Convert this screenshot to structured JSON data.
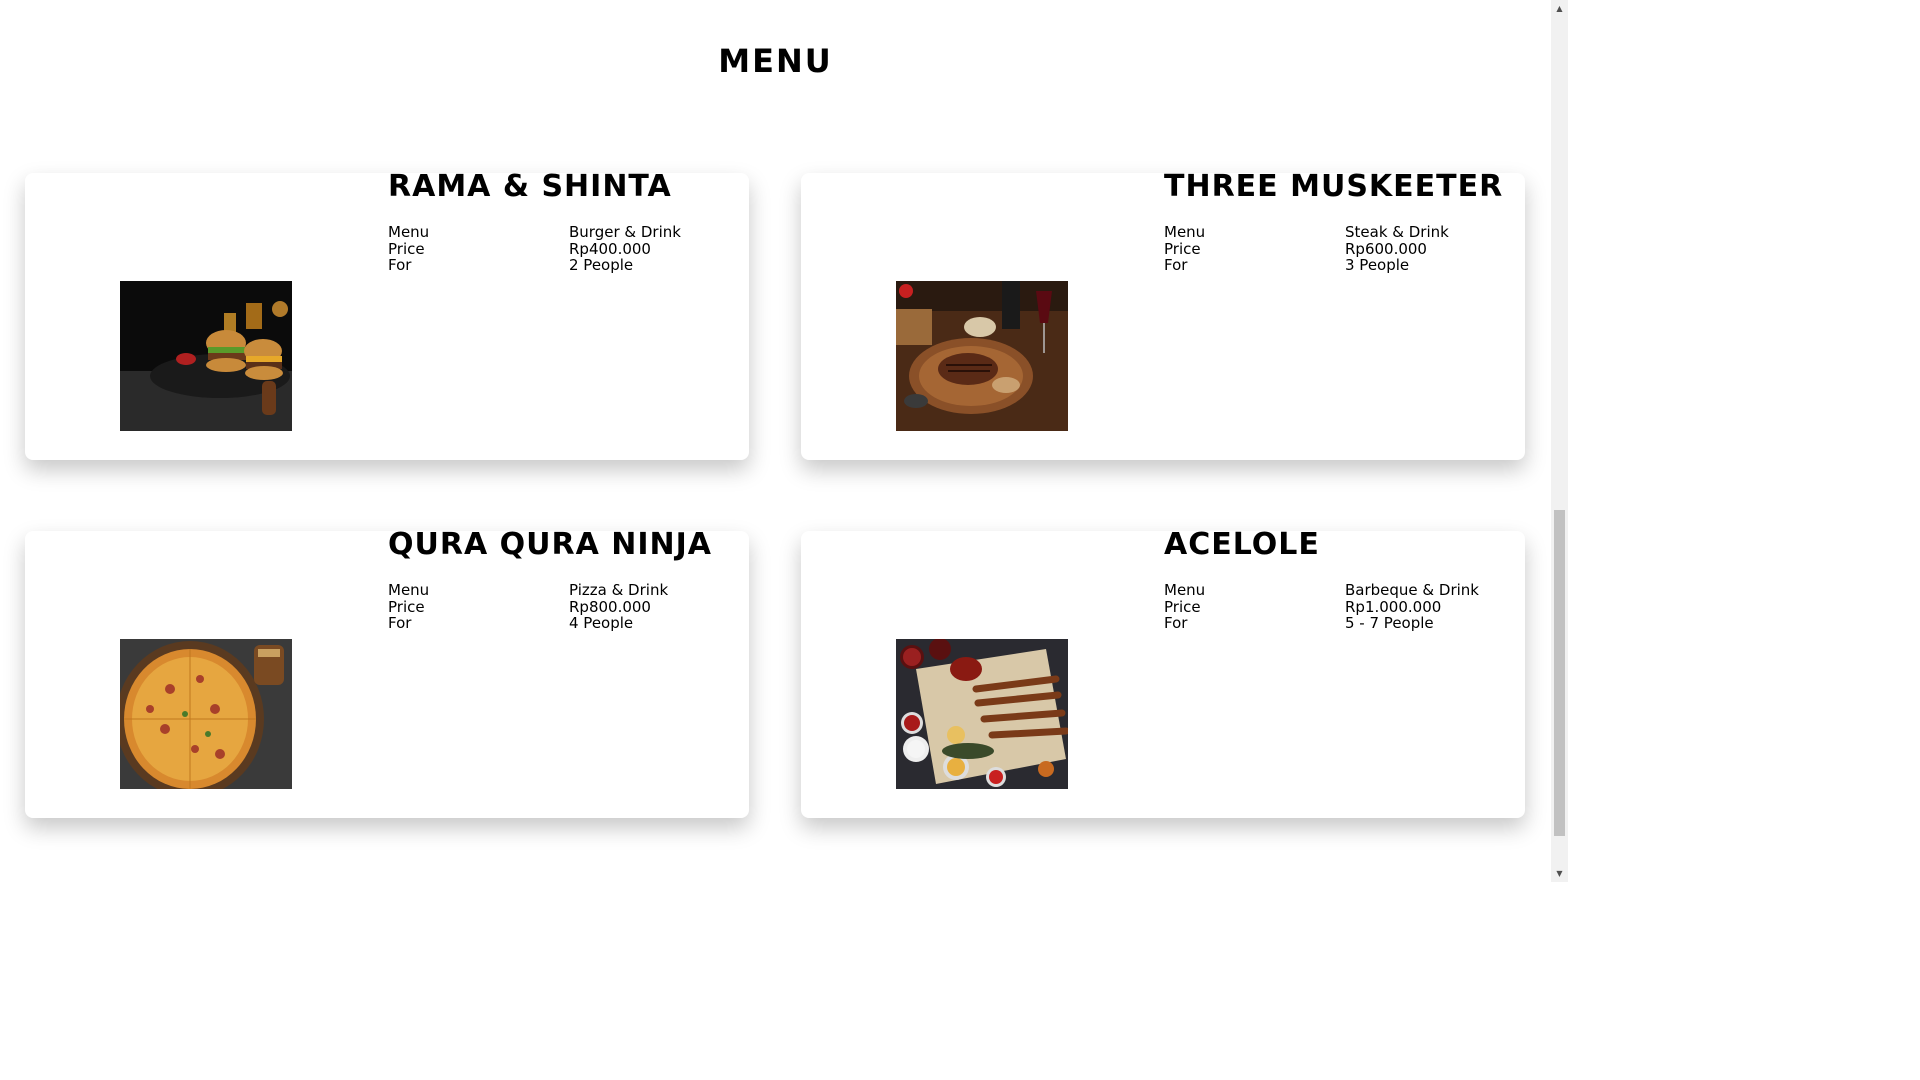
{
  "page": {
    "heading": "MENU"
  },
  "labels": {
    "menu": "Menu",
    "price": "Price",
    "for": "For"
  },
  "packages": [
    {
      "title": "RAMA & SHINTA",
      "menu": "Burger & Drink",
      "price": "Rp400.000",
      "for": "2 People",
      "image": "burger-drink-photo"
    },
    {
      "title": "THREE MUSKEETER",
      "menu": "Steak & Drink",
      "price": "Rp600.000",
      "for": "3 People",
      "image": "steak-drink-photo"
    },
    {
      "title": "QURA QURA NINJA",
      "menu": "Pizza & Drink",
      "price": "Rp800.000",
      "for": "4 People",
      "image": "pizza-drink-photo"
    },
    {
      "title": "ACELOLE",
      "menu": "Barbeque & Drink",
      "price": "Rp1.000.000",
      "for": "5 - 7 People",
      "image": "barbeque-drink-photo"
    }
  ],
  "scrollbar": {
    "up_icon": "arrow-up-icon",
    "down_icon": "arrow-down-icon",
    "position": 0.58
  }
}
